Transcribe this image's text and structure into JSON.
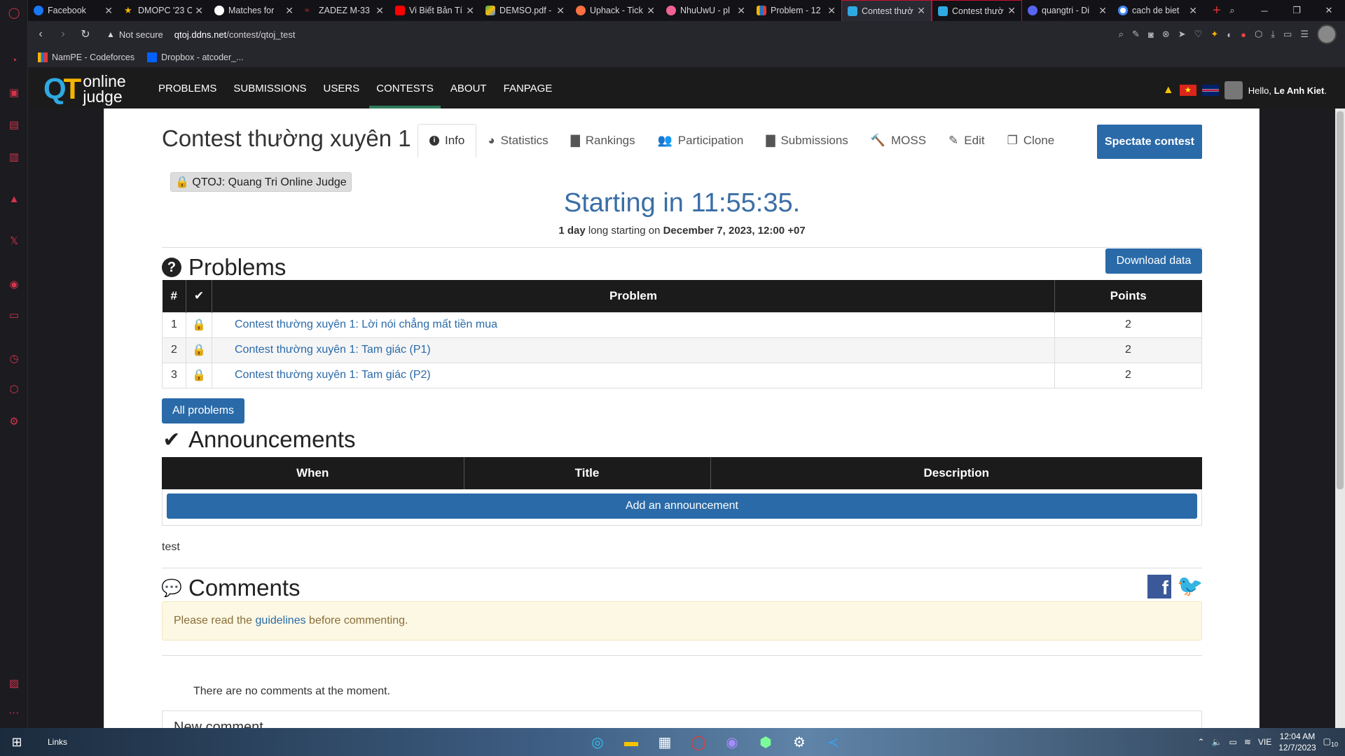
{
  "browser": {
    "tabs": [
      {
        "label": "Facebook",
        "icon": "facebook-icon",
        "color": "#1877f2"
      },
      {
        "label": "DMOPC '23 C",
        "icon": "star-icon",
        "color": "#f5b400"
      },
      {
        "label": "Matches for",
        "icon": "github-icon",
        "color": "#ffffff"
      },
      {
        "label": "ZADEZ M-33",
        "icon": "zadez-icon",
        "color": "#e53935"
      },
      {
        "label": "Vi Biết Bản Tí",
        "icon": "youtube-icon",
        "color": "#ff0000"
      },
      {
        "label": "DEMSO.pdf -",
        "icon": "drive-icon",
        "color": "#34a853"
      },
      {
        "label": "Uphack - Tick",
        "icon": "uphack-icon",
        "color": "#ff7043"
      },
      {
        "label": "NhuUwU - pl",
        "icon": "circle-icon",
        "color": "#f06292"
      },
      {
        "label": "Problem - 12",
        "icon": "codeforces-icon",
        "color": "#1976d2"
      },
      {
        "label": "Contest thườ",
        "icon": "qtoj-icon",
        "color": "#2fa9e1"
      },
      {
        "label": "Contest thườ",
        "icon": "qtoj-icon",
        "color": "#2fa9e1"
      },
      {
        "label": "quangtri - Di",
        "icon": "discord-icon",
        "color": "#5865f2"
      },
      {
        "label": "cach de biet",
        "icon": "google-icon",
        "color": "#4285f4"
      }
    ],
    "address": {
      "security": "Not secure",
      "url_domain": "qtoj.ddns.net",
      "url_path": "/contest/qtoj_test"
    },
    "bookmarks": [
      {
        "label": "NamPE - Codeforces",
        "icon": "codeforces-icon"
      },
      {
        "label": "Dropbox - atcoder_...",
        "icon": "dropbox-icon"
      }
    ]
  },
  "site": {
    "logo_mark": "QT",
    "logo_line1": "online",
    "logo_line2": "judge",
    "nav": [
      "PROBLEMS",
      "SUBMISSIONS",
      "USERS",
      "CONTESTS",
      "ABOUT",
      "FANPAGE"
    ],
    "active_nav": "CONTESTS",
    "greeting_prefix": "Hello, ",
    "username": "Le Anh Kiet",
    "greeting_suffix": "."
  },
  "contest": {
    "title": "Contest thường xuyên 1",
    "tabs": [
      "Info",
      "Statistics",
      "Rankings",
      "Participation",
      "Submissions",
      "MOSS",
      "Edit",
      "Clone"
    ],
    "active_tab": "Info",
    "spectate_label": "Spectate contest",
    "organization": "QTOJ: Quang Tri Online Judge",
    "countdown": "Starting in 11:55:35.",
    "duration_bold": "1 day",
    "duration_mid": " long starting on ",
    "start_time": "December 7, 2023, 12:00 +07"
  },
  "problems": {
    "heading": "Problems",
    "download_label": "Download data",
    "columns": [
      "#",
      "✔",
      "Problem",
      "Points"
    ],
    "rows": [
      {
        "num": "1",
        "name": "Contest thường xuyên 1: Lời nói chẳng mất tiền mua",
        "points": "2"
      },
      {
        "num": "2",
        "name": "Contest thường xuyên 1: Tam giác (P1)",
        "points": "2"
      },
      {
        "num": "3",
        "name": "Contest thường xuyên 1: Tam giác (P2)",
        "points": "2"
      }
    ],
    "all_label": "All problems"
  },
  "announcements": {
    "heading": "Announcements",
    "columns": [
      "When",
      "Title",
      "Description"
    ],
    "add_label": "Add an announcement"
  },
  "description": "test",
  "comments": {
    "heading": "Comments",
    "notice_prefix": "Please read the ",
    "notice_link": "guidelines",
    "notice_suffix": " before commenting.",
    "empty": "There are no comments at the moment.",
    "new_heading": "New comment"
  },
  "taskbar": {
    "links_label": "Links",
    "lang": "VIE",
    "time": "12:04 AM",
    "date": "12/7/2023",
    "notif_count": "10"
  },
  "colors": {
    "accent": "#2a6aa8",
    "nav_bg": "#1c1b1b",
    "active_underline": "#2e7d5b",
    "browser_accent": "#c8102e"
  }
}
